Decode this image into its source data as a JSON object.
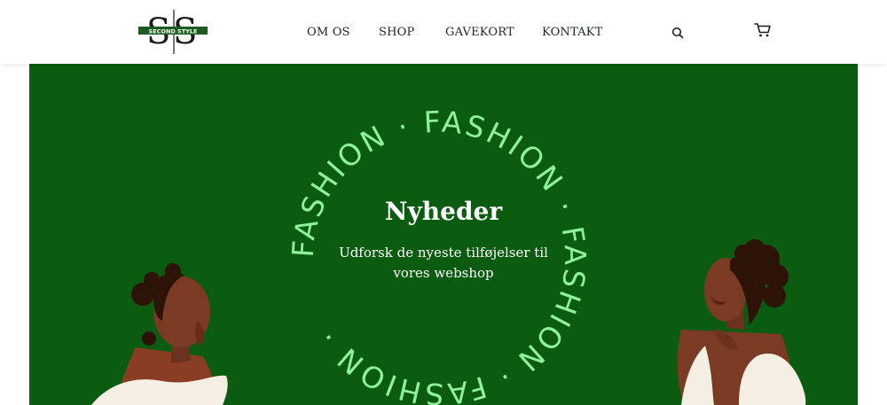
{
  "brand": {
    "logo_text": "SECOND STYLE",
    "logo_letters": "SS"
  },
  "nav": {
    "items": [
      {
        "label": "OM OS"
      },
      {
        "label": "SHOP"
      },
      {
        "label": "GAVEKORT"
      },
      {
        "label": "KONTAKT"
      }
    ]
  },
  "icons": {
    "search": "search-icon",
    "cart": "cart-icon"
  },
  "hero": {
    "ring_text": "FASHION · FASHION · FASHION · FASHION · ",
    "title": "Nyheder",
    "subtitle_line1": "Udforsk de nyeste tilføjelser til",
    "subtitle_line2": "vores webshop"
  },
  "colors": {
    "hero_background": "#0b5c10",
    "ring_text": "#8ef29a",
    "logo_bar": "#1d5c21",
    "nav_text": "#1a2a1a"
  }
}
